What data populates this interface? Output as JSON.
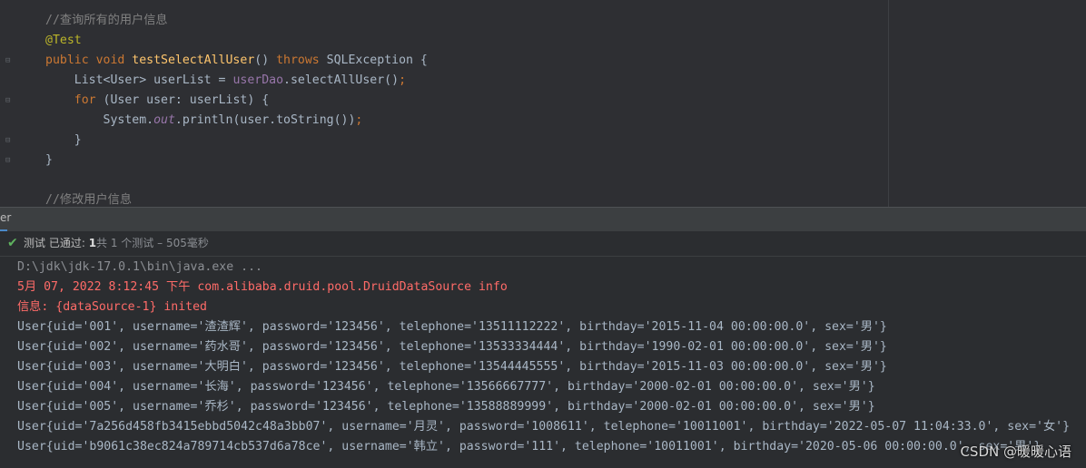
{
  "editor": {
    "lines": [
      {
        "tokens": [
          {
            "t": "//查询所有的用户信息",
            "c": "comment"
          }
        ]
      },
      {
        "tokens": [
          {
            "t": "@Test",
            "c": "annot"
          }
        ]
      },
      {
        "tokens": [
          {
            "t": "public ",
            "c": "kw"
          },
          {
            "t": "void ",
            "c": "kw"
          },
          {
            "t": "testSelectAllUser",
            "c": "method"
          },
          {
            "t": "() ",
            "c": "plain"
          },
          {
            "t": "throws ",
            "c": "kw"
          },
          {
            "t": "SQLException {",
            "c": "plain"
          }
        ]
      },
      {
        "tokens": [
          {
            "t": "    List<User> userList = ",
            "c": "plain"
          },
          {
            "t": "userDao",
            "c": "field"
          },
          {
            "t": ".selectAllUser()",
            "c": "plain"
          },
          {
            "t": ";",
            "c": "kw"
          }
        ]
      },
      {
        "tokens": [
          {
            "t": "    ",
            "c": "plain"
          },
          {
            "t": "for ",
            "c": "kw"
          },
          {
            "t": "(User user: userList) {",
            "c": "plain"
          }
        ]
      },
      {
        "tokens": [
          {
            "t": "        System.",
            "c": "plain"
          },
          {
            "t": "out",
            "c": "static"
          },
          {
            "t": ".println(user.toString())",
            "c": "plain"
          },
          {
            "t": ";",
            "c": "kw"
          }
        ]
      },
      {
        "tokens": [
          {
            "t": "    }",
            "c": "plain"
          }
        ]
      },
      {
        "tokens": [
          {
            "t": "}",
            "c": "plain"
          }
        ]
      },
      {
        "tokens": [
          {
            "t": "",
            "c": "plain"
          }
        ]
      },
      {
        "tokens": [
          {
            "t": "//修改用户信息",
            "c": "comment"
          }
        ]
      }
    ]
  },
  "tool_window": {
    "tab_label": "er"
  },
  "status": {
    "prefix": "测试 已通过: ",
    "passed": "1",
    "detail": "共 1 个测试 – 505毫秒"
  },
  "console": {
    "lines": [
      {
        "text": "D:\\jdk\\jdk-17.0.1\\bin\\java.exe ...",
        "kind": "cmd"
      },
      {
        "text": "5月 07, 2022 8:12:45 下午 com.alibaba.druid.pool.DruidDataSource info",
        "kind": "err"
      },
      {
        "text": "信息: {dataSource-1} inited",
        "kind": "err"
      },
      {
        "text": "User{uid='001', username='渣渣辉', password='123456', telephone='13511112222', birthday='2015-11-04 00:00:00.0', sex='男'}",
        "kind": "out"
      },
      {
        "text": "User{uid='002', username='药水哥', password='123456', telephone='13533334444', birthday='1990-02-01 00:00:00.0', sex='男'}",
        "kind": "out"
      },
      {
        "text": "User{uid='003', username='大明白', password='123456', telephone='13544445555', birthday='2015-11-03 00:00:00.0', sex='男'}",
        "kind": "out"
      },
      {
        "text": "User{uid='004', username='长海', password='123456', telephone='13566667777', birthday='2000-02-01 00:00:00.0', sex='男'}",
        "kind": "out"
      },
      {
        "text": "User{uid='005', username='乔杉', password='123456', telephone='13588889999', birthday='2000-02-01 00:00:00.0', sex='男'}",
        "kind": "out"
      },
      {
        "text": "User{uid='7a256d458fb3415ebbd5042c48a3bb07', username='月灵', password='1008611', telephone='10011001', birthday='2022-05-07 11:04:33.0', sex='女'}",
        "kind": "out"
      },
      {
        "text": "User{uid='b9061c38ec824a789714cb537d6a78ce', username='韩立', password='111', telephone='10011001', birthday='2020-05-06 00:00:00.0', sex='男'}",
        "kind": "out"
      }
    ],
    "watermark": "CSDN @暖暖心语"
  }
}
